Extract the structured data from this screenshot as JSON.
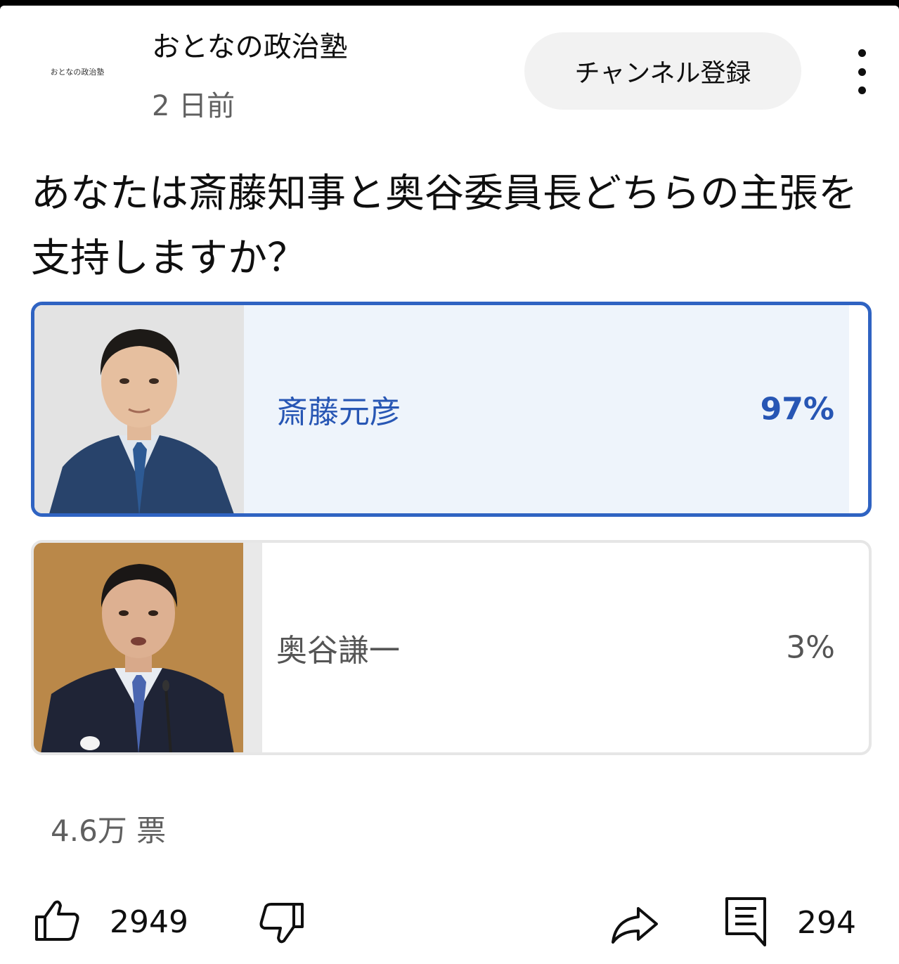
{
  "channel": {
    "avatar_text": "おとなの政治塾",
    "name": "おとなの政治塾",
    "posted": "2 日前",
    "subscribe_label": "チャンネル登録"
  },
  "poll": {
    "question": "あなたは斎藤知事と奥谷委員長どちらの主張を支持しますか？",
    "options": [
      {
        "label": "斎藤元彦",
        "percent_label": "97%",
        "percent": 97,
        "selected": true
      },
      {
        "label": "奥谷謙一",
        "percent_label": "3%",
        "percent": 3,
        "selected": false
      }
    ],
    "total_votes": "4.6万 票"
  },
  "actions": {
    "likes": "2949",
    "comments": "294"
  },
  "colors": {
    "accent": "#2f63c2",
    "selected_fill": "#eef4fb",
    "text_secondary": "#606060"
  },
  "icons": [
    "more-vert-icon",
    "like-icon",
    "dislike-icon",
    "share-icon",
    "comment-icon"
  ]
}
